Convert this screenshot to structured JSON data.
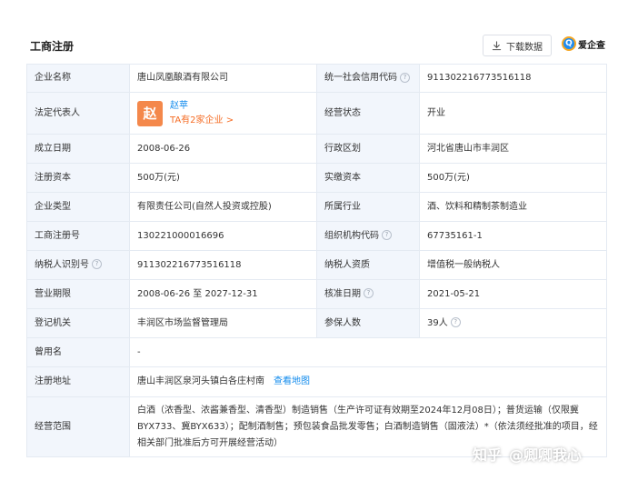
{
  "header": {
    "title": "工商注册",
    "download_label": "下载数据",
    "brand_name": "爱企查",
    "brand_glyph": "Q"
  },
  "company": {
    "rows": [
      {
        "label": "企业名称",
        "value": "唐山凤凰酿酒有限公司",
        "label2": "统一社会信用代码",
        "value2": "911302216773516118"
      },
      {
        "label": "法定代表人",
        "label2": "经营状态",
        "value2": "开业"
      },
      {
        "label": "成立日期",
        "value": "2008-06-26",
        "label2": "行政区划",
        "value2": "河北省唐山市丰润区"
      },
      {
        "label": "注册资本",
        "value": "500万(元)",
        "label2": "实缴资本",
        "value2": "500万(元)"
      },
      {
        "label": "企业类型",
        "value": "有限责任公司(自然人投资或控股)",
        "label2": "所属行业",
        "value2": "酒、饮料和精制茶制造业"
      },
      {
        "label": "工商注册号",
        "value": "130221000016696",
        "label2": "组织机构代码",
        "value2": "67735161-1"
      },
      {
        "label": "纳税人识别号",
        "value": "911302216773516118",
        "label2": "纳税人资质",
        "value2": "增值税一般纳税人"
      },
      {
        "label": "营业期限",
        "value": "2008-06-26 至 2027-12-31",
        "label2": "核准日期",
        "value2": "2021-05-21"
      },
      {
        "label": "登记机关",
        "value": "丰润区市场监督管理局",
        "label2": "参保人数",
        "value2": "39人"
      },
      {
        "label": "曾用名",
        "value": "-"
      },
      {
        "label": "注册地址",
        "value": "唐山丰润区泉河头镇白各庄村南"
      },
      {
        "label": "经营范围",
        "value": "白酒（浓香型、浓酱兼香型、清香型）制造销售（生产许可证有效期至2024年12月08日）；普货运输（仅限冀BYX733、冀BYX633）；配制酒制售；预包装食品批发零售；白酒制造销售（固液法）*（依法须经批准的项目，经相关部门批准后方可开展经营活动）"
      }
    ],
    "representative": {
      "avatar_char": "赵",
      "name": "赵苹",
      "related": "TA有2家企业 >"
    },
    "address_link": "查看地图"
  },
  "watermark": {
    "site": "知乎",
    "author": "@卿卿我心"
  },
  "colors": {
    "label_bg": "#f2f6fc",
    "border": "#e4eaf2",
    "link": "#128bed",
    "accent_orange": "#f56c24",
    "avatar_bg": "#f4884b"
  }
}
